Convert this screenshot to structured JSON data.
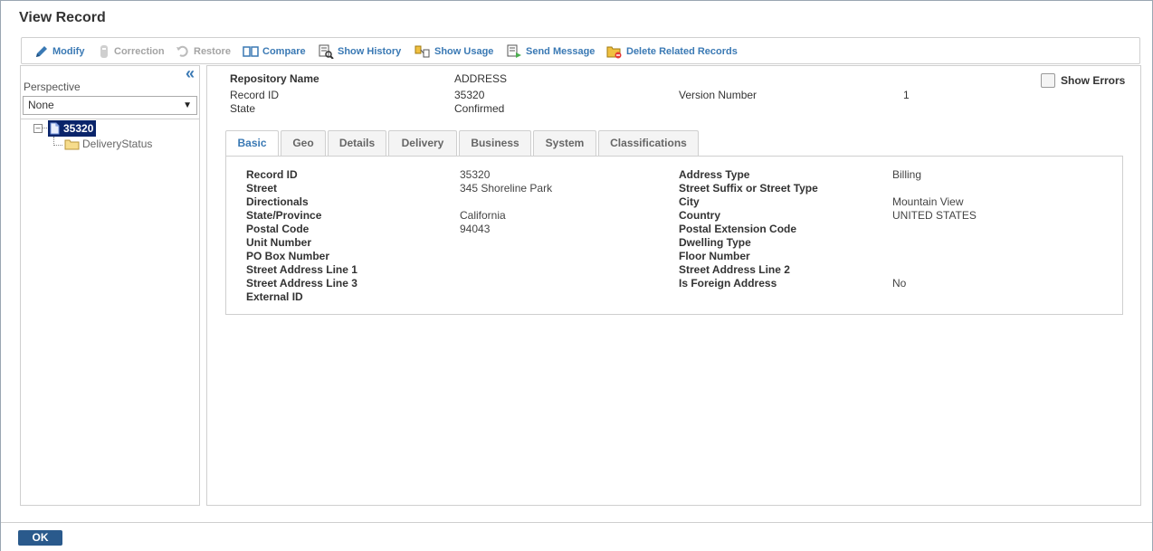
{
  "title": "View Record",
  "toolbar": {
    "modify": "Modify",
    "correction": "Correction",
    "restore": "Restore",
    "compare": "Compare",
    "show_history": "Show History",
    "show_usage": "Show Usage",
    "send_message": "Send Message",
    "delete_related": "Delete Related Records"
  },
  "left": {
    "perspective_label": "Perspective",
    "perspective_value": "None",
    "tree_root": "35320",
    "tree_child": "DeliveryStatus"
  },
  "header": {
    "repository_name_label": "Repository Name",
    "repository_name_value": "ADDRESS",
    "record_id_label": "Record ID",
    "record_id_value": "35320",
    "version_label": "Version Number",
    "version_value": "1",
    "state_label": "State",
    "state_value": "Confirmed",
    "show_errors": "Show Errors"
  },
  "tabs": [
    "Basic",
    "Geo",
    "Details",
    "Delivery",
    "Business",
    "System",
    "Classifications"
  ],
  "fields": {
    "left": [
      {
        "label": "Record ID",
        "value": "35320"
      },
      {
        "label": "Street",
        "value": "345 Shoreline Park"
      },
      {
        "label": "Directionals",
        "value": ""
      },
      {
        "label": "State/Province",
        "value": "California"
      },
      {
        "label": "Postal Code",
        "value": "94043"
      },
      {
        "label": "Unit Number",
        "value": ""
      },
      {
        "label": "PO Box Number",
        "value": ""
      },
      {
        "label": "Street Address Line 1",
        "value": ""
      },
      {
        "label": "Street Address Line 3",
        "value": ""
      },
      {
        "label": "External ID",
        "value": ""
      }
    ],
    "right": [
      {
        "label": "Address Type",
        "value": "Billing"
      },
      {
        "label": "Street Suffix or Street Type",
        "value": ""
      },
      {
        "label": "City",
        "value": "Mountain View"
      },
      {
        "label": "Country",
        "value": "UNITED STATES"
      },
      {
        "label": "Postal Extension Code",
        "value": ""
      },
      {
        "label": "Dwelling Type",
        "value": ""
      },
      {
        "label": "Floor Number",
        "value": ""
      },
      {
        "label": "Street Address Line 2",
        "value": ""
      },
      {
        "label": "Is Foreign Address",
        "value": "No"
      }
    ]
  },
  "ok_label": "OK"
}
